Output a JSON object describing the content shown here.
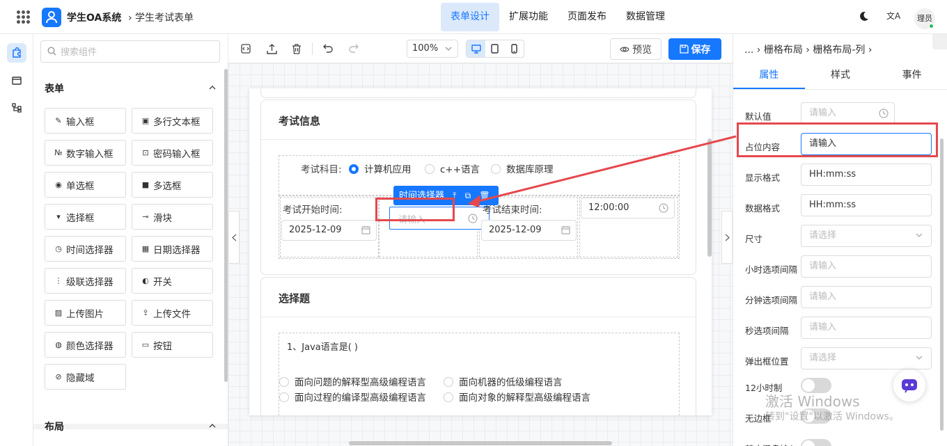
{
  "header": {
    "app_title": "学生OA系统",
    "breadcrumb": "› 学生考试表单",
    "nav": [
      "表单设计",
      "扩展功能",
      "页面发布",
      "数据管理"
    ],
    "active_nav": 0,
    "lang_glyph": "文A",
    "user": "理员"
  },
  "components": {
    "search_placeholder": "搜索组件",
    "form_section": "表单",
    "layout_section": "布局",
    "items": [
      {
        "label": "输入框",
        "icon": "edit-icon"
      },
      {
        "label": "多行文本框",
        "icon": "textarea-icon"
      },
      {
        "label": "数字输入框",
        "icon": "number-icon"
      },
      {
        "label": "密码输入框",
        "icon": "lock-icon"
      },
      {
        "label": "单选框",
        "icon": "radio-icon"
      },
      {
        "label": "多选框",
        "icon": "checkbox-icon"
      },
      {
        "label": "选择框",
        "icon": "select-icon"
      },
      {
        "label": "滑块",
        "icon": "slider-icon"
      },
      {
        "label": "时间选择器",
        "icon": "clock-icon"
      },
      {
        "label": "日期选择器",
        "icon": "calendar-icon"
      },
      {
        "label": "级联选择器",
        "icon": "cascader-icon"
      },
      {
        "label": "开关",
        "icon": "switch-icon"
      },
      {
        "label": "上传图片",
        "icon": "image-icon"
      },
      {
        "label": "上传文件",
        "icon": "upload-icon"
      },
      {
        "label": "颜色选择器",
        "icon": "palette-icon"
      },
      {
        "label": "按钮",
        "icon": "button-icon"
      },
      {
        "label": "隐藏域",
        "icon": "eye-off-icon"
      }
    ]
  },
  "toolbar": {
    "zoom": "100%",
    "preview": "预览",
    "save": "保存"
  },
  "form": {
    "exam_card_title": "考试信息",
    "subject_label": "考试科目:",
    "subject_options": [
      "计算机应用",
      "c++语言",
      "数据库原理"
    ],
    "selected_subject": 0,
    "selected_tag": "时间选择器",
    "start_label": "考试开始时间:",
    "start_date": "2025-12-09",
    "start_time_placeholder": "请输入",
    "end_label": "考试结束时间:",
    "end_date": "2025-12-09",
    "end_time": "12:00:00",
    "choice_card_title": "选择题",
    "question": "1、Java语言是( )",
    "answers": [
      "面向问题的解释型高级编程语言",
      "面向机器的低级编程语言",
      "面向过程的编译型高级编程语言",
      "面向对象的解释型高级编程语言"
    ]
  },
  "props": {
    "breadcrumb": "... › 栅格布局 › 栅格布局-列 ›",
    "tabs": [
      "属性",
      "样式",
      "事件"
    ],
    "active_tab": 0,
    "rows": [
      {
        "label": "默认值",
        "value": "请输入",
        "placeholder": true,
        "suffix": "clock"
      },
      {
        "label": "占位内容",
        "value": "请输入",
        "placeholder": false,
        "focus": true
      },
      {
        "label": "显示格式",
        "value": "HH:mm:ss",
        "placeholder": false
      },
      {
        "label": "数据格式",
        "value": "HH:mm:ss",
        "placeholder": false
      },
      {
        "label": "尺寸",
        "value": "请选择",
        "placeholder": true,
        "suffix": "chevron"
      },
      {
        "label": "小时选项间隔",
        "value": "请输入",
        "placeholder": true
      },
      {
        "label": "分钟选项间隔",
        "value": "请输入",
        "placeholder": true
      },
      {
        "label": "秒选项间隔",
        "value": "请输入",
        "placeholder": true
      },
      {
        "label": "弹出框位置",
        "value": "请选择",
        "placeholder": true,
        "suffix": "chevron"
      }
    ],
    "toggles": [
      "12小时制",
      "无边框",
      "禁止键盘输入"
    ]
  },
  "watermark": {
    "line1": "激活 Windows",
    "line2": "转到\"设置\"以激活 Windows。"
  },
  "colors": {
    "primary": "#1677ff",
    "highlight": "#e5484d"
  }
}
